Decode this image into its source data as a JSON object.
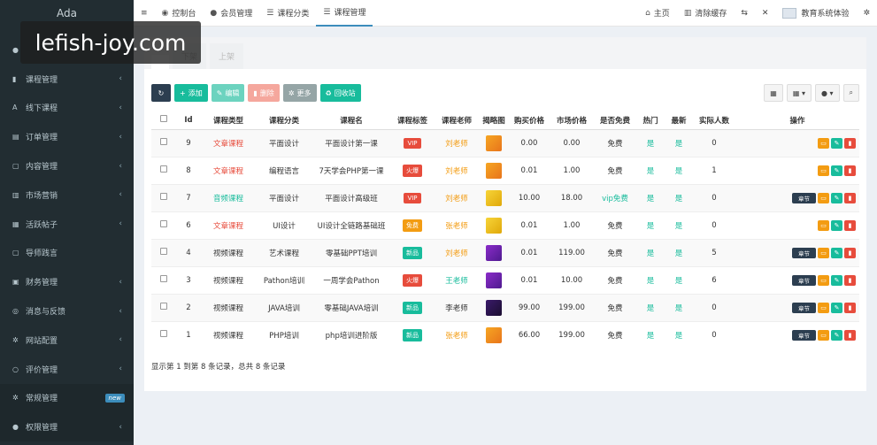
{
  "brand": "Ada",
  "watermark": "lefish-joy.com",
  "sidebar": {
    "items": [
      {
        "label": "",
        "icon": "user-icon",
        "arrow": ""
      },
      {
        "label": "课程管理",
        "icon": "book-icon",
        "arrow": "‹"
      },
      {
        "label": "线下课程",
        "icon": "font-icon",
        "arrow": "‹"
      },
      {
        "label": "订单管理",
        "icon": "list-icon",
        "arrow": "‹"
      },
      {
        "label": "内容管理",
        "icon": "file-icon",
        "arrow": "‹"
      },
      {
        "label": "市场营销",
        "icon": "chart-icon",
        "arrow": "‹"
      },
      {
        "label": "活跃帖子",
        "icon": "doc-icon",
        "arrow": "‹"
      },
      {
        "label": "导师践言",
        "icon": "note-icon",
        "arrow": ""
      },
      {
        "label": "财务管理",
        "icon": "bank-icon",
        "arrow": "‹"
      },
      {
        "label": "消息与反馈",
        "icon": "message-icon",
        "arrow": "‹"
      },
      {
        "label": "网站配置",
        "icon": "settings-icon",
        "arrow": "‹"
      },
      {
        "label": "评价管理",
        "icon": "circle-icon",
        "arrow": "‹"
      },
      {
        "label": "常规管理",
        "icon": "cogs-icon",
        "arrow": "",
        "badge": "new"
      },
      {
        "label": "权限管理",
        "icon": "users-icon",
        "arrow": "‹"
      }
    ]
  },
  "topbar": {
    "menu_icon": "≡",
    "nav": [
      {
        "label": "控制台",
        "icon": "dashboard-icon"
      },
      {
        "label": "会员管理",
        "icon": "user-icon"
      },
      {
        "label": "课程分类",
        "icon": "list-icon"
      },
      {
        "label": "课程管理",
        "icon": "list-icon"
      }
    ],
    "home": "主页",
    "clear_cache": "清除缓存",
    "user_name": "教育系统体验"
  },
  "tabs": [
    "",
    "下架",
    "上架"
  ],
  "toolbar": {
    "add": "添加",
    "edit": "编辑",
    "delete": "删除",
    "more": "更多",
    "recycle": "回收站"
  },
  "table": {
    "headers": [
      "Id",
      "课程类型",
      "课程分类",
      "课程名",
      "课程标签",
      "课程老师",
      "揭略图",
      "购买价格",
      "市场价格",
      "是否免费",
      "热门",
      "最新",
      "实际人数",
      "操作"
    ],
    "rows": [
      {
        "id": "9",
        "type": "文章课程",
        "category": "平面设计",
        "name": "平面设计第一课",
        "tag": "VIP",
        "teacher": "刘老师",
        "price": "0.00",
        "market": "0.00",
        "free": "免费",
        "hot": "是",
        "new": "是",
        "count": "0"
      },
      {
        "id": "8",
        "type": "文章课程",
        "category": "编程语言",
        "name": "7天学会PHP第一课",
        "tag": "火爆",
        "teacher": "刘老师",
        "price": "0.01",
        "market": "1.00",
        "free": "免费",
        "hot": "是",
        "new": "是",
        "count": "1"
      },
      {
        "id": "7",
        "type": "音频课程",
        "category": "平面设计",
        "name": "平面设计高级班",
        "tag": "VIP",
        "teacher": "刘老师",
        "price": "10.00",
        "market": "18.00",
        "free": "vip免费",
        "hot": "是",
        "new": "是",
        "count": "0"
      },
      {
        "id": "6",
        "type": "文章课程",
        "category": "UI设计",
        "name": "UI设计全链路基础班",
        "tag": "免费",
        "teacher": "张老师",
        "price": "0.01",
        "market": "1.00",
        "free": "免费",
        "hot": "是",
        "new": "是",
        "count": "0"
      },
      {
        "id": "4",
        "type": "视频课程",
        "category": "艺术课程",
        "name": "零基础PPT培训",
        "tag": "新品",
        "teacher": "刘老师",
        "price": "0.01",
        "market": "119.00",
        "free": "免费",
        "hot": "是",
        "new": "是",
        "count": "5"
      },
      {
        "id": "3",
        "type": "视频课程",
        "category": "Pathon培训",
        "name": "一周学会Pathon",
        "tag": "火爆",
        "teacher": "王老师",
        "price": "0.01",
        "market": "10.00",
        "free": "免费",
        "hot": "是",
        "new": "是",
        "count": "6"
      },
      {
        "id": "2",
        "type": "视频课程",
        "category": "JAVA培训",
        "name": "零基础JAVA培训",
        "tag": "新品",
        "teacher": "李老师",
        "price": "99.00",
        "market": "199.00",
        "free": "免费",
        "hot": "是",
        "new": "是",
        "count": "0"
      },
      {
        "id": "1",
        "type": "视频课程",
        "category": "PHP培训",
        "name": "php培训进阶版",
        "tag": "新品",
        "teacher": "张老师",
        "price": "66.00",
        "market": "199.00",
        "free": "免费",
        "hot": "是",
        "new": "是",
        "count": "0"
      }
    ],
    "chapter_label": "章节"
  },
  "footer": "显示第 1 到第 8 条记录，总共 8 条记录"
}
